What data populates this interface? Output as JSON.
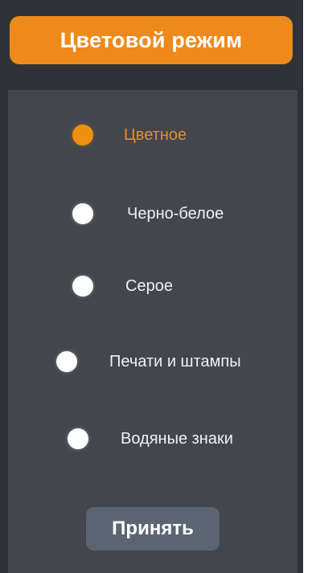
{
  "header": {
    "title": "Цветовой режим"
  },
  "options": [
    {
      "label": "Цветное",
      "selected": true
    },
    {
      "label": "Черно-белое",
      "selected": false
    },
    {
      "label": "Серое",
      "selected": false
    },
    {
      "label": "Печати и штампы",
      "selected": false
    },
    {
      "label": "Водяные знаки",
      "selected": false
    }
  ],
  "actions": {
    "accept_label": "Принять"
  },
  "colors": {
    "panel_bg": "#2f3338",
    "content_bg": "#43464d",
    "accent": "#ee8a1c",
    "selected_text": "#e88b2a",
    "button_bg": "#5b6572"
  }
}
